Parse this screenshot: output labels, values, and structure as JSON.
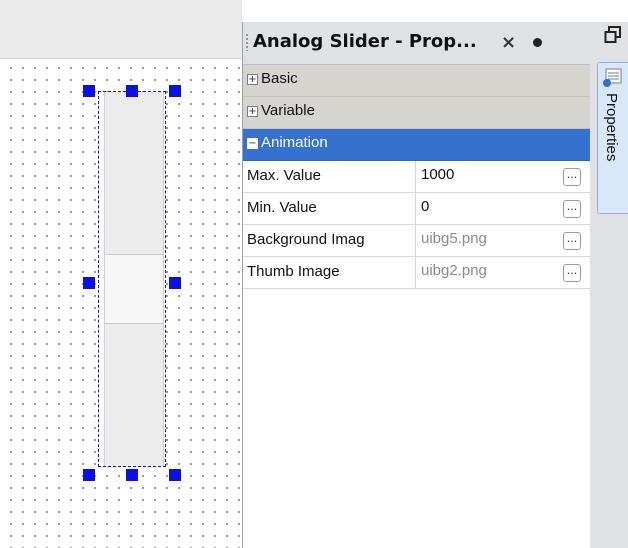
{
  "panel": {
    "title": "Analog Slider - Prop...",
    "close_glyph": "×",
    "categories": [
      {
        "label": "Basic",
        "toggle": "+"
      },
      {
        "label": "Variable",
        "toggle": "+"
      },
      {
        "label": "Animation",
        "toggle": "−"
      }
    ],
    "properties": [
      {
        "name": "Max. Value",
        "value": "1000",
        "button": "..."
      },
      {
        "name": "Min. Value",
        "value": "0",
        "button": "..."
      },
      {
        "name": "Background Imag",
        "value": "uibg5.png",
        "button": "..."
      },
      {
        "name": "Thumb Image",
        "value": "uibg2.png",
        "button": "..."
      }
    ]
  },
  "dock": {
    "tab_label": "Properties"
  },
  "colors": {
    "selection_handle": "#0b10e6",
    "active_category": "#3572cf"
  }
}
